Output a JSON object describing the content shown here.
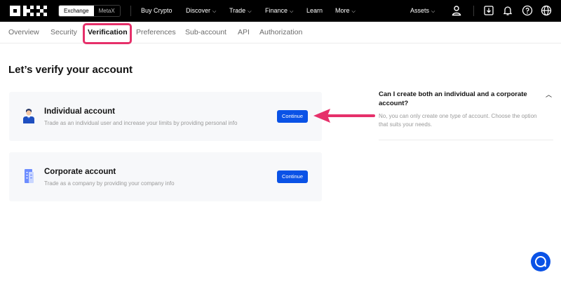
{
  "nav": {
    "switch_on": "Exchange",
    "switch_off": "MetaX",
    "items": [
      "Buy Crypto",
      "Discover",
      "Trade",
      "Finance",
      "Learn",
      "More"
    ],
    "assets": "Assets",
    "icons": [
      "user-icon",
      "download-icon",
      "bell-icon",
      "help-icon",
      "globe-icon"
    ]
  },
  "tabs": [
    "Overview",
    "Security",
    "Verification",
    "Preferences",
    "Sub-account",
    "API",
    "Authorization"
  ],
  "page_title": "Let’s verify your account",
  "cards": [
    {
      "title": "Individual account",
      "desc": "Trade as an individual user and increase your limits by providing personal info",
      "button": "Continue",
      "icon": "person-icon"
    },
    {
      "title": "Corporate account",
      "desc": "Trade as a company by providing your company info",
      "button": "Continue",
      "icon": "building-icon"
    }
  ],
  "faq": {
    "question": "Can I create both an individual and a corporate account?",
    "answer": "No, you can only create one type of account. Choose the option that suits your needs."
  },
  "colors": {
    "accent": "#0a52e6",
    "highlight": "#e6306a"
  }
}
